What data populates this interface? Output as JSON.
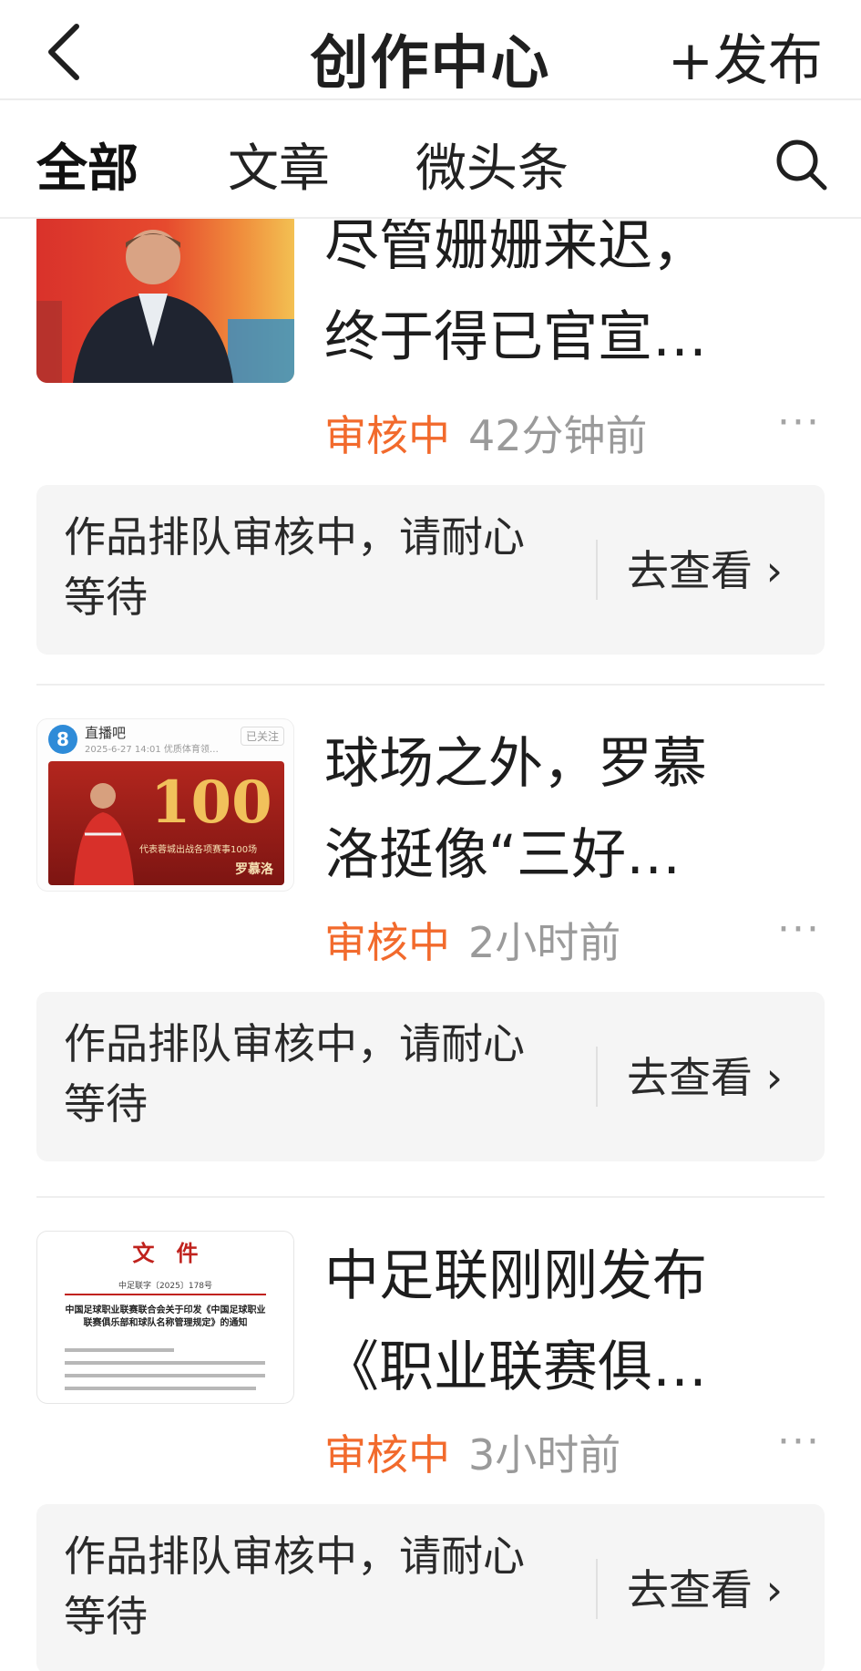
{
  "header": {
    "title": "创作中心",
    "publish_label": "+发布"
  },
  "tabs": [
    {
      "label": "全部"
    },
    {
      "label": "文章"
    },
    {
      "label": "微头条"
    }
  ],
  "colors": {
    "status_accent": "#f26a2c",
    "notice_bg": "#f5f5f5",
    "muted_text": "#9a9a9a"
  },
  "items": [
    {
      "headline_line1": "尽管姗姗来迟，",
      "headline_line2": "终于得已官宣…",
      "status": "审核中",
      "time": "42分钟前",
      "more": "···",
      "notice": "作品排队审核中，请耐心等待",
      "action": "去查看 ›"
    },
    {
      "headline_line1": "球场之外，罗慕",
      "headline_line2": "洛挺像“三好…",
      "status": "审核中",
      "time": "2小时前",
      "more": "···",
      "notice": "作品排队审核中，请耐心等待",
      "action": "去查看 ›",
      "thumb": {
        "account": "直播吧",
        "date_line": "2025-6-27 14:01 优质体育领…",
        "follow": "已关注",
        "big_number": "100",
        "caption": "代表蓉城出战各项赛事100场",
        "player": "罗慕洛"
      }
    },
    {
      "headline_line1": "中足联刚刚发布",
      "headline_line2": "《职业联赛俱…",
      "status": "审核中",
      "time": "3小时前",
      "more": "···",
      "notice": "作品排队审核中，请耐心等待",
      "action": "去查看 ›",
      "thumb": {
        "doc_title": "文　件",
        "doc_no": "中足联字〔2025〕178号",
        "doc_heading": "中国足球职业联赛联合会关于印发《中国足球职业联赛俱乐部和球队名称管理规定》的通知"
      }
    }
  ]
}
